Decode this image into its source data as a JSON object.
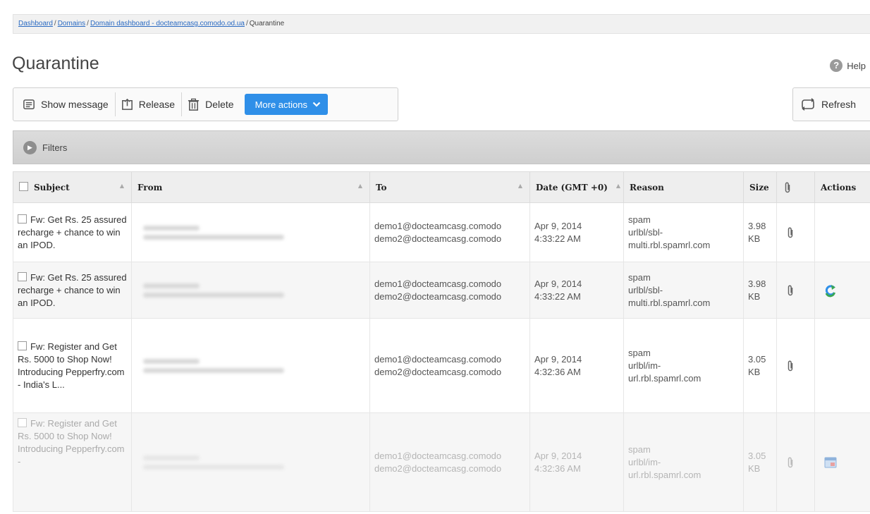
{
  "breadcrumb": {
    "items": [
      "Dashboard",
      "Domains",
      "Domain dashboard - docteamcasg.comodo.od.ua"
    ],
    "current": "Quarantine"
  },
  "page": {
    "title": "Quarantine",
    "help_label": "Help"
  },
  "toolbar": {
    "show_message": "Show message",
    "release": "Release",
    "delete": "Delete",
    "more_actions": "More actions",
    "refresh": "Refresh"
  },
  "filters": {
    "label": "Filters"
  },
  "table": {
    "columns": [
      "Subject",
      "From",
      "To",
      "Date (GMT +0)",
      "Reason",
      "Size",
      "",
      "Actions"
    ],
    "rows": [
      {
        "subject": "Fw: Get Rs. 25 assured recharge + chance to win an IPOD.",
        "to": [
          "demo1@docteamcasg.comodo",
          "demo2@docteamcasg.comodo"
        ],
        "date": [
          "Apr 9, 2014",
          "4:33:22 AM"
        ],
        "reason": [
          "spam",
          "urlbl/sbl-",
          "multi.rbl.spamrl.com"
        ],
        "size": [
          "3.98",
          "KB"
        ],
        "action_icon": "none"
      },
      {
        "subject": "Fw: Get Rs. 25 assured recharge + chance to win an IPOD.",
        "to": [
          "demo1@docteamcasg.comodo",
          "demo2@docteamcasg.comodo"
        ],
        "date": [
          "Apr 9, 2014",
          "4:33:22 AM"
        ],
        "reason": [
          "spam",
          "urlbl/sbl-",
          "multi.rbl.spamrl.com"
        ],
        "size": [
          "3.98",
          "KB"
        ],
        "action_icon": "release-arrow-icon"
      },
      {
        "subject": "Fw: Register and Get Rs. 5000 to Shop Now! Introducing Pepperfry.com - India's L...",
        "to": [
          "demo1@docteamcasg.comodo",
          "demo2@docteamcasg.comodo"
        ],
        "date": [
          "Apr 9, 2014",
          "4:32:36 AM"
        ],
        "reason": [
          "spam",
          "urlbl/im-",
          "url.rbl.spamrl.com"
        ],
        "size": [
          "3.05",
          "KB"
        ],
        "action_icon": "none"
      },
      {
        "subject": "Fw: Register and Get Rs. 5000 to Shop Now! Introducing Pepperfry.com -",
        "to": [
          "demo1@docteamcasg.comodo",
          "demo2@docteamcasg.comodo"
        ],
        "date": [
          "Apr 9, 2014",
          "4:32:36 AM"
        ],
        "reason": [
          "spam",
          "urlbl/im-",
          "url.rbl.spamrl.com"
        ],
        "size": [
          "3.05",
          "KB"
        ],
        "action_icon": "show-message-icon"
      }
    ]
  },
  "colors": {
    "accent": "#2f8fe8",
    "link": "#2a6ac2"
  }
}
